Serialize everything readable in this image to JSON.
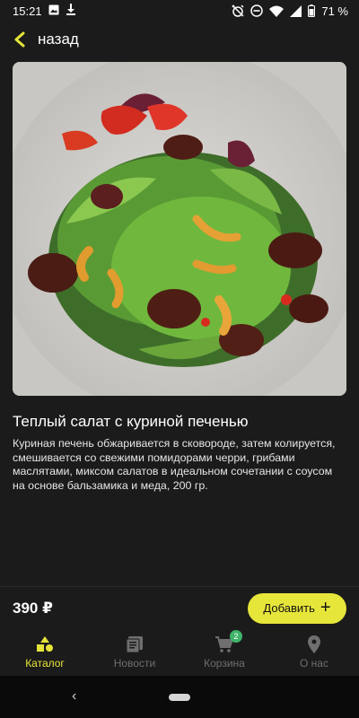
{
  "status": {
    "time": "15:21",
    "battery": "71 %"
  },
  "nav": {
    "back_label": "назад"
  },
  "product": {
    "title": "Теплый салат с куриной печенью",
    "description": "Куриная печень обжаривается в сковороде, затем колируется, смешивается со свежими помидорами черри, грибами маслятами, миксом салатов в идеальном сочетании с  соусом на основе бальзамика и меда, 200 гр.",
    "price": "390 ₽",
    "add_label": "Добавить"
  },
  "tabs": [
    {
      "label": "Каталог",
      "icon": "catalog-shapes-icon",
      "active": true
    },
    {
      "label": "Новости",
      "icon": "news-icon",
      "active": false
    },
    {
      "label": "Корзина",
      "icon": "cart-icon",
      "active": false,
      "badge": "2"
    },
    {
      "label": "О нас",
      "icon": "location-pin-icon",
      "active": false
    }
  ],
  "colors": {
    "accent": "#e6e53a",
    "background": "#1b1b1b",
    "badge": "#3fb36a",
    "inactive": "#6f6f6f"
  }
}
